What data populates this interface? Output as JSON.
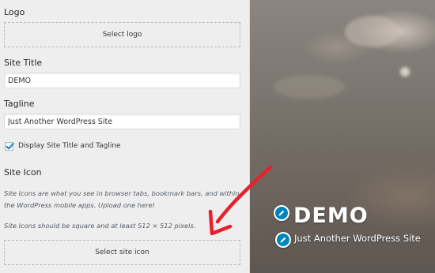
{
  "panel": {
    "logo_label": "Logo",
    "select_logo_button": "Select logo",
    "site_title_label": "Site Title",
    "site_title_value": "DEMO",
    "tagline_label": "Tagline",
    "tagline_value": "Just Another WordPress Site",
    "display_checkbox_label": "Display Site Title and Tagline",
    "display_checkbox_checked": true,
    "site_icon_heading": "Site Icon",
    "site_icon_description_1": "Site Icons are what you see in browser tabs, bookmark bars, and within the WordPress mobile apps. Upload one here!",
    "site_icon_description_2": "Site Icons should be square and at least 512 × 512 pixels.",
    "select_site_icon_button": "Select site icon"
  },
  "preview": {
    "site_title": "DEMO",
    "tagline": "Just Another WordPress Site",
    "edit_icon": "pencil-icon",
    "edit_shortcut_color": "#0085ba"
  },
  "annotation": {
    "arrow_color": "#e8202a"
  }
}
